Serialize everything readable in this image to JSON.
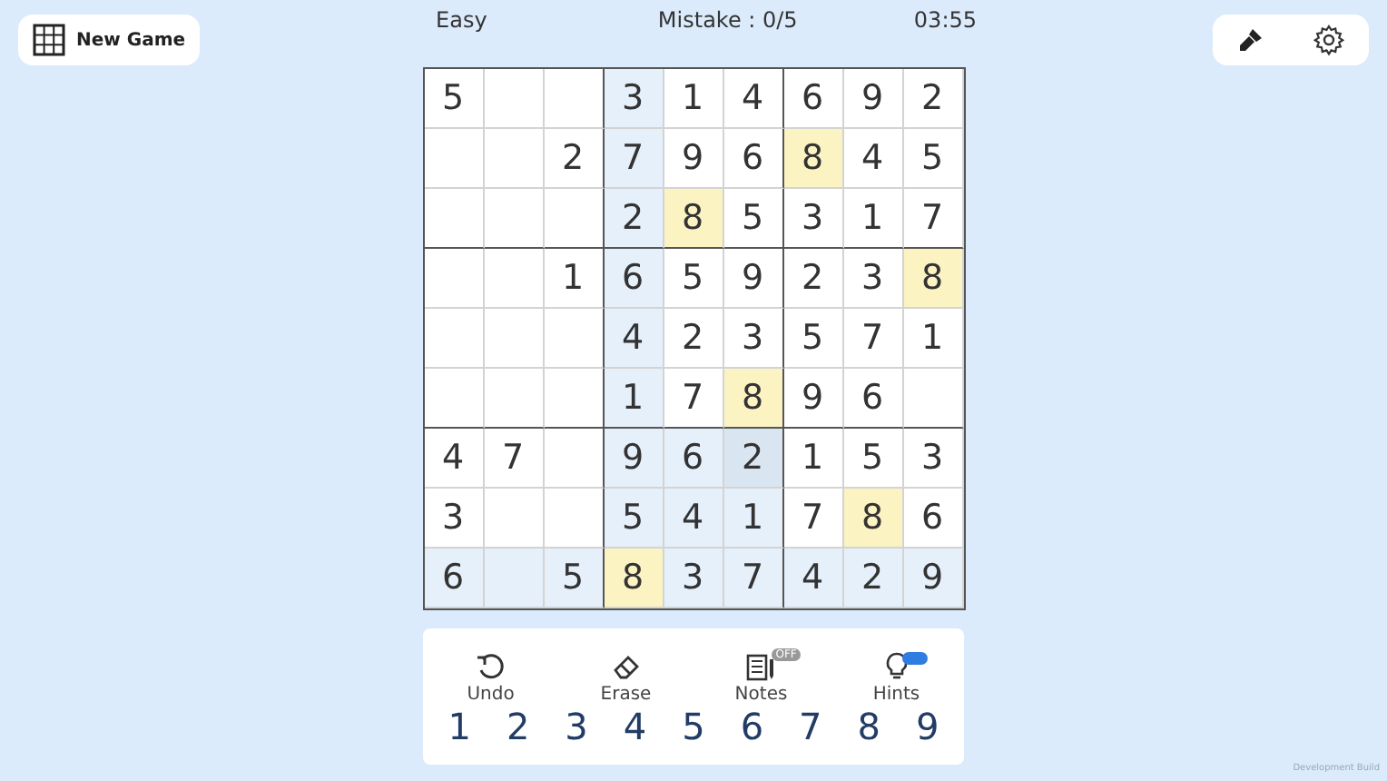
{
  "header": {
    "new_game": "New Game",
    "difficulty": "Easy",
    "mistakes": "Mistake : 0/5",
    "timer": "03:55"
  },
  "board": [
    [
      {
        "v": "5",
        "peer": false,
        "same": false,
        "focus": false
      },
      {
        "peer": false,
        "same": false,
        "focus": false
      },
      {
        "peer": false,
        "same": false,
        "focus": false
      },
      {
        "v": "3",
        "peer": true,
        "same": false,
        "focus": false
      },
      {
        "v": "1",
        "peer": false,
        "same": false,
        "focus": false
      },
      {
        "v": "4",
        "peer": false,
        "same": false,
        "focus": false
      },
      {
        "v": "6",
        "peer": false,
        "same": false,
        "focus": false
      },
      {
        "v": "9",
        "peer": false,
        "same": false,
        "focus": false
      },
      {
        "v": "2",
        "peer": false,
        "same": false,
        "focus": false
      }
    ],
    [
      {
        "peer": false,
        "same": false,
        "focus": false
      },
      {
        "peer": false,
        "same": false,
        "focus": false
      },
      {
        "v": "2",
        "peer": false,
        "same": false,
        "focus": false
      },
      {
        "v": "7",
        "peer": true,
        "same": false,
        "focus": false
      },
      {
        "v": "9",
        "peer": false,
        "same": false,
        "focus": false
      },
      {
        "v": "6",
        "peer": false,
        "same": false,
        "focus": false
      },
      {
        "v": "8",
        "peer": false,
        "same": true,
        "focus": false
      },
      {
        "v": "4",
        "peer": false,
        "same": false,
        "focus": false
      },
      {
        "v": "5",
        "peer": false,
        "same": false,
        "focus": false
      }
    ],
    [
      {
        "peer": false,
        "same": false,
        "focus": false
      },
      {
        "peer": false,
        "same": false,
        "focus": false
      },
      {
        "peer": false,
        "same": false,
        "focus": false
      },
      {
        "v": "2",
        "peer": true,
        "same": false,
        "focus": false
      },
      {
        "v": "8",
        "peer": false,
        "same": true,
        "focus": false
      },
      {
        "v": "5",
        "peer": false,
        "same": false,
        "focus": false
      },
      {
        "v": "3",
        "peer": false,
        "same": false,
        "focus": false
      },
      {
        "v": "1",
        "peer": false,
        "same": false,
        "focus": false
      },
      {
        "v": "7",
        "peer": false,
        "same": false,
        "focus": false
      }
    ],
    [
      {
        "peer": false,
        "same": false,
        "focus": false
      },
      {
        "peer": false,
        "same": false,
        "focus": false
      },
      {
        "v": "1",
        "peer": false,
        "same": false,
        "focus": false
      },
      {
        "v": "6",
        "peer": true,
        "same": false,
        "focus": false
      },
      {
        "v": "5",
        "peer": false,
        "same": false,
        "focus": false
      },
      {
        "v": "9",
        "peer": false,
        "same": false,
        "focus": false
      },
      {
        "v": "2",
        "peer": false,
        "same": false,
        "focus": false
      },
      {
        "v": "3",
        "peer": false,
        "same": false,
        "focus": false
      },
      {
        "v": "8",
        "peer": false,
        "same": true,
        "focus": false
      }
    ],
    [
      {
        "peer": false,
        "same": false,
        "focus": false
      },
      {
        "peer": false,
        "same": false,
        "focus": false
      },
      {
        "peer": false,
        "same": false,
        "focus": false
      },
      {
        "v": "4",
        "peer": true,
        "same": false,
        "focus": false
      },
      {
        "v": "2",
        "peer": false,
        "same": false,
        "focus": false
      },
      {
        "v": "3",
        "peer": false,
        "same": false,
        "focus": false
      },
      {
        "v": "5",
        "peer": false,
        "same": false,
        "focus": false
      },
      {
        "v": "7",
        "peer": false,
        "same": false,
        "focus": false
      },
      {
        "v": "1",
        "peer": false,
        "same": false,
        "focus": false
      }
    ],
    [
      {
        "peer": false,
        "same": false,
        "focus": false
      },
      {
        "peer": false,
        "same": false,
        "focus": false
      },
      {
        "peer": false,
        "same": false,
        "focus": false
      },
      {
        "v": "1",
        "peer": true,
        "same": false,
        "focus": false
      },
      {
        "v": "7",
        "peer": false,
        "same": false,
        "focus": false
      },
      {
        "v": "8",
        "peer": false,
        "same": true,
        "focus": false
      },
      {
        "v": "9",
        "peer": false,
        "same": false,
        "focus": false
      },
      {
        "v": "6",
        "peer": false,
        "same": false,
        "focus": false
      },
      {
        "peer": false,
        "same": false,
        "focus": false
      }
    ],
    [
      {
        "v": "4",
        "peer": false,
        "same": false,
        "focus": false
      },
      {
        "v": "7",
        "peer": false,
        "same": false,
        "focus": false
      },
      {
        "peer": false,
        "same": false,
        "focus": false
      },
      {
        "v": "9",
        "peer": true,
        "same": false,
        "focus": false
      },
      {
        "v": "6",
        "peer": true,
        "same": false,
        "focus": false
      },
      {
        "v": "2",
        "peer": true,
        "same": false,
        "focus": true
      },
      {
        "v": "1",
        "peer": false,
        "same": false,
        "focus": false
      },
      {
        "v": "5",
        "peer": false,
        "same": false,
        "focus": false
      },
      {
        "v": "3",
        "peer": false,
        "same": false,
        "focus": false
      }
    ],
    [
      {
        "v": "3",
        "peer": false,
        "same": false,
        "focus": false
      },
      {
        "peer": false,
        "same": false,
        "focus": false
      },
      {
        "peer": false,
        "same": false,
        "focus": false
      },
      {
        "v": "5",
        "peer": true,
        "same": false,
        "focus": false
      },
      {
        "v": "4",
        "peer": true,
        "same": false,
        "focus": false
      },
      {
        "v": "1",
        "peer": true,
        "same": false,
        "focus": false
      },
      {
        "v": "7",
        "peer": false,
        "same": false,
        "focus": false
      },
      {
        "v": "8",
        "peer": false,
        "same": true,
        "focus": false
      },
      {
        "v": "6",
        "peer": false,
        "same": false,
        "focus": false
      }
    ],
    [
      {
        "v": "6",
        "peer": true,
        "same": false,
        "focus": false
      },
      {
        "peer": true,
        "same": false,
        "focus": false
      },
      {
        "v": "5",
        "peer": true,
        "same": false,
        "focus": false
      },
      {
        "v": "8",
        "peer": false,
        "same": true,
        "focus": false
      },
      {
        "v": "3",
        "peer": true,
        "same": false,
        "focus": false
      },
      {
        "v": "7",
        "peer": true,
        "same": false,
        "focus": false
      },
      {
        "v": "4",
        "peer": true,
        "same": false,
        "focus": false
      },
      {
        "v": "2",
        "peer": true,
        "same": false,
        "focus": false
      },
      {
        "v": "9",
        "peer": true,
        "same": false,
        "focus": false
      }
    ]
  ],
  "tools": [
    {
      "kind": "undo",
      "label": "Undo"
    },
    {
      "kind": "erase",
      "label": "Erase"
    },
    {
      "kind": "notes",
      "label": "Notes",
      "badge": "OFF"
    },
    {
      "kind": "hints",
      "label": "Hints"
    }
  ],
  "numbers": [
    "1",
    "2",
    "3",
    "4",
    "5",
    "6",
    "7",
    "8",
    "9"
  ],
  "footer": "Development Build"
}
